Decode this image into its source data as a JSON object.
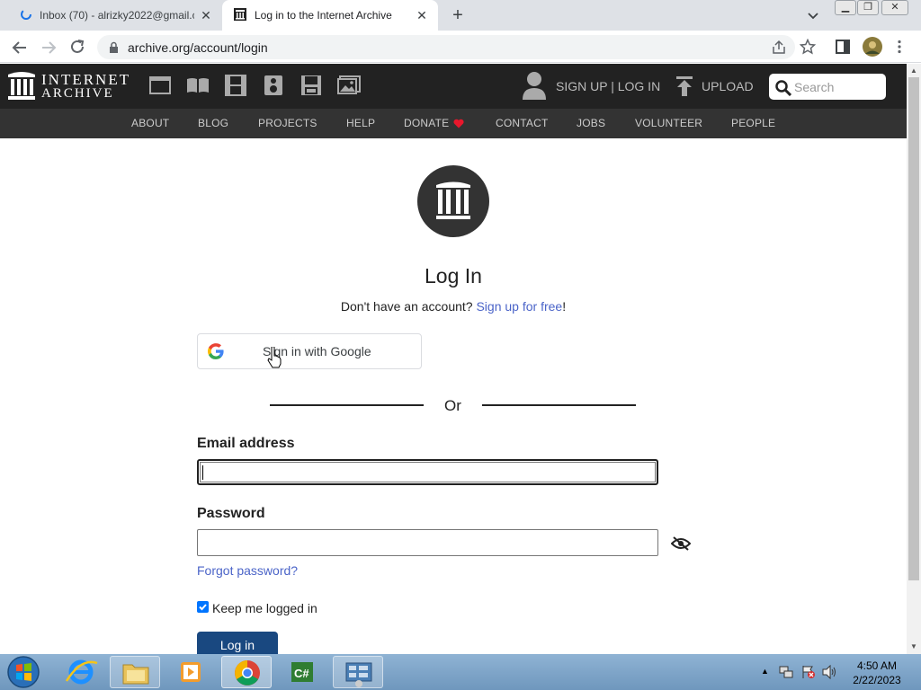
{
  "browser": {
    "tabs": [
      {
        "title": "Inbox (70) - alrizky2022@gmail.c",
        "active": false
      },
      {
        "title": "Log in to the Internet Archive",
        "active": true
      }
    ],
    "url": "archive.org/account/login"
  },
  "ia_header": {
    "logo_line1": "INTERNET",
    "logo_line2": "ARCHIVE",
    "media_icons": [
      "web-icon",
      "texts-icon",
      "video-icon",
      "audio-icon",
      "software-icon",
      "images-icon"
    ],
    "signup_login": "SIGN UP | LOG IN",
    "upload": "UPLOAD",
    "search_placeholder": "Search",
    "nav": [
      "ABOUT",
      "BLOG",
      "PROJECTS",
      "HELP",
      "DONATE",
      "CONTACT",
      "JOBS",
      "VOLUNTEER",
      "PEOPLE"
    ]
  },
  "login": {
    "title": "Log In",
    "no_account": "Don't have an account?",
    "signup_link": "Sign up for free",
    "signup_suffix": "!",
    "google_button": "Sign in with Google",
    "or": "Or",
    "email_label": "Email address",
    "email_value": "",
    "password_label": "Password",
    "password_value": "",
    "forgot": "Forgot password?",
    "keep_logged_in": "Keep me logged in",
    "keep_checked": true,
    "submit": "Log in"
  },
  "taskbar": {
    "apps": [
      "windows-start",
      "internet-explorer",
      "file-explorer",
      "media-player",
      "chrome",
      "visual-csharp",
      "control-panel"
    ],
    "time": "4:50 AM",
    "date": "2/22/2023"
  },
  "colors": {
    "ia_header_bg": "#222222",
    "ia_subnav_bg": "#333333",
    "link": "#4b64c8",
    "login_button": "#194880",
    "heart": "#e8172c"
  }
}
